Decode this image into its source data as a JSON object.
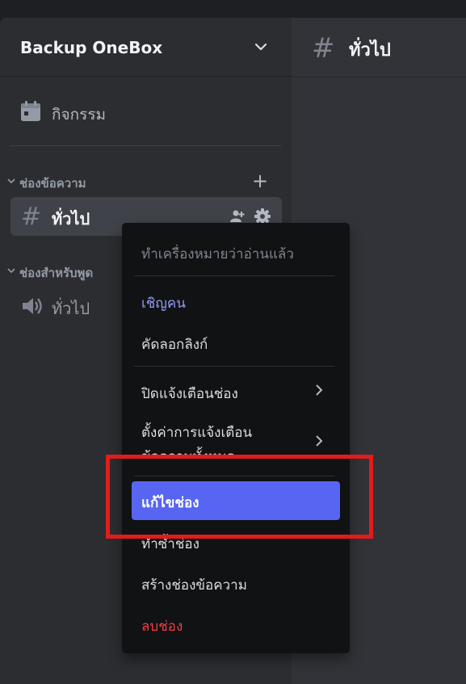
{
  "server": {
    "name": "Backup OneBox"
  },
  "events": {
    "label": "กิจกรรม"
  },
  "categories": {
    "text": {
      "label": "ช่องข้อความ"
    },
    "voice": {
      "label": "ช่องสำหรับพูด"
    }
  },
  "channels": {
    "text_active": {
      "name": "ทั่วไป"
    },
    "voice": {
      "name": "ทั่วไป"
    }
  },
  "main": {
    "title": "ทั่วไป"
  },
  "context_menu": {
    "mark_read": "ทำเครื่องหมายว่าอ่านแล้ว",
    "invite": "เชิญคน",
    "copy_link": "คัดลอกลิงก์",
    "mute": "ปิดแจ้งเตือนช่อง",
    "notif_line1": "ตั้งค่าการแจ้งเตือน",
    "notif_line2": "ข้อความทั้งหมด",
    "edit": "แก้ไขช่อง",
    "duplicate": "ทำซ้ำช่อง",
    "create": "สร้างช่องข้อความ",
    "delete": "ลบช่อง"
  },
  "colors": {
    "accent": "#5865f2",
    "danger": "#f23f43",
    "highlight": "#e21b1b"
  }
}
